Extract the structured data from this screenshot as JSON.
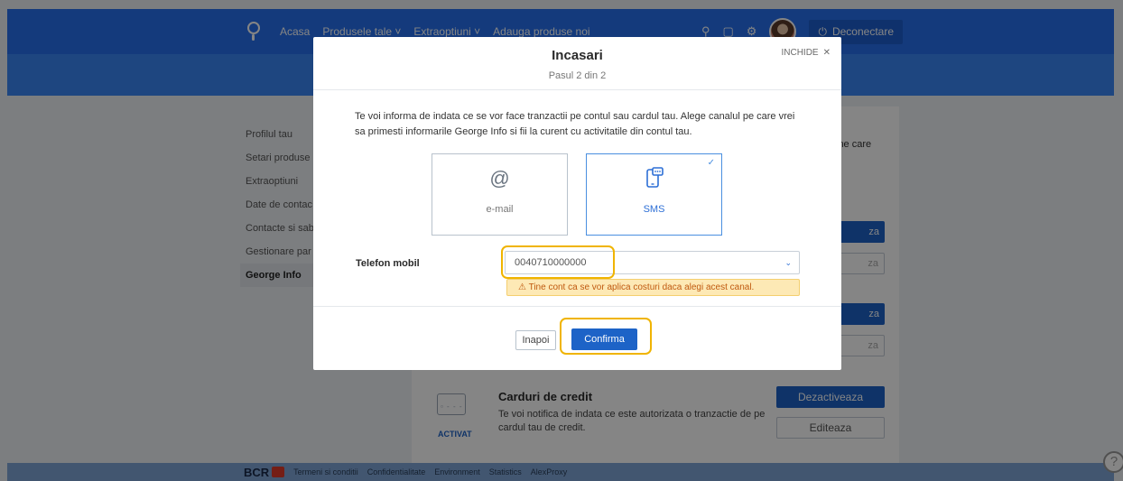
{
  "nav": {
    "links": [
      "Acasa",
      "Produsele tale ˅",
      "Extraoptiuni ˅",
      "Adauga produse noi"
    ],
    "logout_label": "Deconectare",
    "icons": [
      "search-icon",
      "chat-icon",
      "settings-icon"
    ]
  },
  "sidebar": {
    "items": [
      {
        "label": "Profilul tau"
      },
      {
        "label": "Setari produse"
      },
      {
        "label": "Extraoptiuni"
      },
      {
        "label": "Date de contac"
      },
      {
        "label": "Contacte si sab"
      },
      {
        "label": "Gestionare par"
      },
      {
        "label": "George Info",
        "active": true
      }
    ]
  },
  "background": {
    "edge_text": "ine care",
    "side_buttons": [
      "za",
      "za",
      "za",
      "za"
    ],
    "credit_cards": {
      "title": "Carduri de credit",
      "description": "Te voi notifica de indata ce este autorizata o tranzactie de pe cardul tau de credit.",
      "status": "ACTIVAT",
      "deactivate_label": "Dezactiveaza",
      "edit_label": "Editeaza"
    }
  },
  "footer": {
    "brand": "BCR",
    "links": [
      "Termeni si conditii",
      "Confidentialitate",
      "Environment",
      "Statistics",
      "AlexProxy"
    ]
  },
  "modal": {
    "title": "Incasari",
    "step": "Pasul 2 din 2",
    "close_label": "INCHIDE",
    "intro": "Te voi informa de indata ce se vor face tranzactii pe contul sau cardul tau. Alege canalul pe care vrei sa primesti informarile George Info si fii la curent cu activitatile din contul tau.",
    "channels": [
      {
        "label": "e-mail",
        "icon": "@",
        "selected": false
      },
      {
        "label": "SMS",
        "icon": "phone-chat",
        "selected": true
      }
    ],
    "phone_label": "Telefon mobil",
    "phone_value": "0040710000000",
    "warning": "Tine cont ca se vor aplica costuri daca alegi acest canal.",
    "back_label": "Inapoi",
    "confirm_label": "Confirma"
  },
  "colors": {
    "primary": "#1d63c7",
    "nav": "#2870ed",
    "highlight": "#f0b400",
    "warning_bg": "#fde9b5"
  }
}
